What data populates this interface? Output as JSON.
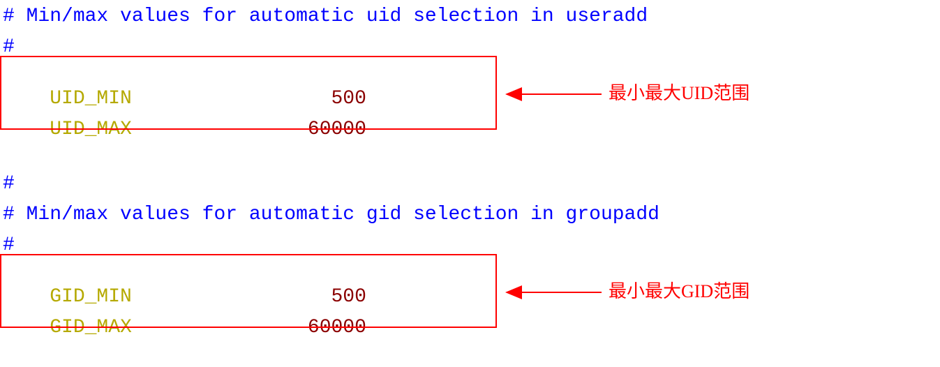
{
  "lines": {
    "c1": "# Min/max values for automatic uid selection in useradd",
    "c2": "#",
    "uid_min_key": "UID_MIN",
    "uid_min_val": "500",
    "uid_max_key": "UID_MAX",
    "uid_max_val": "60000",
    "c3": "#",
    "c4": "# Min/max values for automatic gid selection in groupadd",
    "c5": "#",
    "gid_min_key": "GID_MIN",
    "gid_min_val": "500",
    "gid_max_key": "GID_MAX",
    "gid_max_val": "60000"
  },
  "annotations": {
    "uid_label": "最小最大UID范围",
    "gid_label": "最小最大GID范围"
  }
}
